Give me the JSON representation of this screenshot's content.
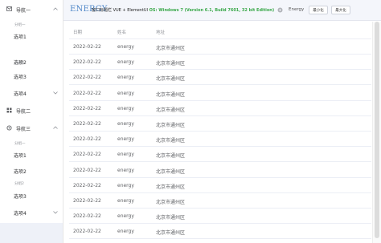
{
  "sidebar": {
    "nav1": {
      "title": "导航一"
    },
    "group1": {
      "title": "分组一"
    },
    "nav1_items": [
      {
        "label": "选项1"
      },
      {
        "label": "选项2"
      }
    ],
    "group2": {
      "title": "分组2"
    },
    "nav1_item3": {
      "label": "选项3"
    },
    "nav1_item4": {
      "label": "选项4"
    },
    "nav2": {
      "title": "导航二"
    },
    "nav3": {
      "title": "导航三"
    },
    "group3": {
      "title": "分组一"
    },
    "nav3_items": [
      {
        "label": "选项1"
      },
      {
        "label": "选项2"
      }
    ],
    "group4": {
      "title": "分组2"
    },
    "nav3_item3": {
      "label": "选项3"
    },
    "nav3_item4": {
      "label": "选项4"
    }
  },
  "topbar": {
    "brand": "ENERGY",
    "window_title": "窗口标题栏 VUE + ElementUI",
    "os_info": "OS: Windows 7 (Version 6.1, Build 7601, 32 bit Edition)",
    "user": "Energy",
    "min_label": "最小化",
    "max_label": "最大化",
    "gear_icon": "gear-icon"
  },
  "table": {
    "headers": {
      "date": "日期",
      "name": "姓名",
      "address": "地址"
    },
    "rows": [
      {
        "date": "2022-02-22",
        "name": "energy",
        "address": "北京市通州区"
      },
      {
        "date": "2022-02-22",
        "name": "energy",
        "address": "北京市通州区"
      },
      {
        "date": "2022-02-22",
        "name": "energy",
        "address": "北京市通州区"
      },
      {
        "date": "2022-02-22",
        "name": "energy",
        "address": "北京市通州区"
      },
      {
        "date": "2022-02-22",
        "name": "energy",
        "address": "北京市通州区"
      },
      {
        "date": "2022-02-22",
        "name": "energy",
        "address": "北京市通州区"
      },
      {
        "date": "2022-02-22",
        "name": "energy",
        "address": "北京市通州区"
      },
      {
        "date": "2022-02-22",
        "name": "energy",
        "address": "北京市通州区"
      },
      {
        "date": "2022-02-22",
        "name": "energy",
        "address": "北京市通州区"
      },
      {
        "date": "2022-02-22",
        "name": "energy",
        "address": "北京市通州区"
      },
      {
        "date": "2022-02-22",
        "name": "energy",
        "address": "北京市通州区"
      },
      {
        "date": "2022-02-22",
        "name": "energy",
        "address": "北京市通州区"
      },
      {
        "date": "2022-02-22",
        "name": "energy",
        "address": "北京市通州区"
      },
      {
        "date": "2022-02-22",
        "name": "energy",
        "address": "北京市通州区"
      }
    ]
  },
  "colors": {
    "brand": "#4e86c7",
    "os_info": "#3aa84a",
    "active_bg": "#eef1f8"
  }
}
